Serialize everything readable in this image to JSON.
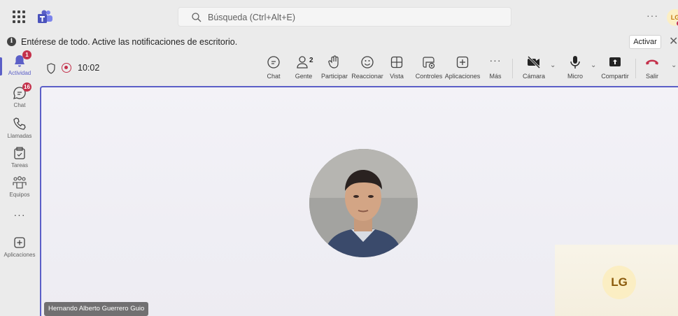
{
  "search": {
    "placeholder": "Búsqueda (Ctrl+Alt+E)"
  },
  "user": {
    "initials": "LG"
  },
  "banner": {
    "message": "Entérese de todo. Active las notificaciones de escritorio.",
    "activate_label": "Activar"
  },
  "rail": {
    "items": [
      {
        "label": "Actividad",
        "icon": "bell-icon",
        "badge": "1"
      },
      {
        "label": "Chat",
        "icon": "chat-icon",
        "badge": "16"
      },
      {
        "label": "Llamadas",
        "icon": "phone-icon"
      },
      {
        "label": "Tareas",
        "icon": "tasks-icon"
      },
      {
        "label": "Equipos",
        "icon": "teams-icon"
      },
      {
        "label": "",
        "icon": "more-icon"
      },
      {
        "label": "Aplicaciones",
        "icon": "add-apps-icon"
      }
    ]
  },
  "meeting": {
    "timer": "10:02",
    "people_count": "2",
    "toolbar": {
      "chat": "Chat",
      "people": "Gente",
      "raise": "Participar",
      "react": "Reaccionar",
      "view": "Vista",
      "controls": "Controles",
      "apps": "Aplicaciones",
      "more": "Más",
      "camera": "Cámara",
      "mic": "Micro",
      "share": "Compartir",
      "leave": "Salir"
    },
    "participant_name": "Hernando Alberto Guerrero Guio",
    "self_initials": "LG"
  },
  "colors": {
    "accent": "#5b5fc7",
    "leave": "#c4314b"
  }
}
